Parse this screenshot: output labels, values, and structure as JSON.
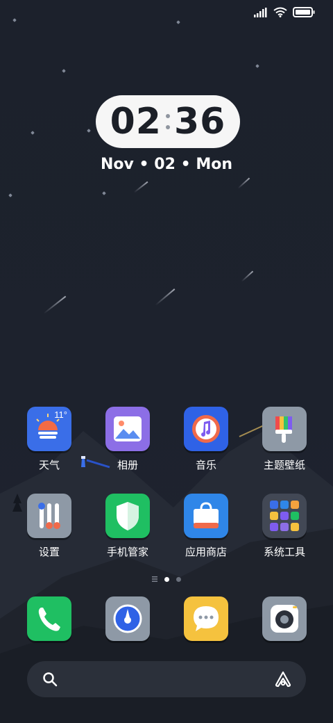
{
  "status_bar": {
    "signal_icon": "signal-icon",
    "wifi_icon": "wifi-icon",
    "battery_icon": "battery-icon"
  },
  "clock": {
    "hours": "02",
    "minutes": "36"
  },
  "date": {
    "month": "Nov",
    "day": "02",
    "weekday": "Mon",
    "separator": "•"
  },
  "apps": [
    {
      "label": "天气",
      "icon": "weather-icon",
      "temp": "11°",
      "color": "#3a6ee8"
    },
    {
      "label": "相册",
      "icon": "gallery-icon",
      "color": "#8c6ee6"
    },
    {
      "label": "音乐",
      "icon": "music-icon",
      "color": "#2f62e6"
    },
    {
      "label": "主题壁纸",
      "icon": "theme-icon",
      "color": "#8e99a6"
    },
    {
      "label": "设置",
      "icon": "settings-icon",
      "color": "#8e99a6"
    },
    {
      "label": "手机管家",
      "icon": "security-icon",
      "color": "#1fbf62"
    },
    {
      "label": "应用商店",
      "icon": "app-store-icon",
      "color": "#2f86e8"
    },
    {
      "label": "系统工具",
      "icon": "system-tools-folder-icon",
      "color": "#424855"
    }
  ],
  "page_indicator": {
    "current": 1,
    "total": 2
  },
  "dock": [
    {
      "icon": "phone-icon",
      "color": "#1fbf62"
    },
    {
      "icon": "browser-icon",
      "color": "#8e99a6"
    },
    {
      "icon": "messages-icon",
      "color": "#f5c23e"
    },
    {
      "icon": "camera-icon",
      "color": "#8e99a6"
    }
  ],
  "search": {
    "search_icon": "search-icon",
    "assistant_icon": "assistant-icon"
  }
}
